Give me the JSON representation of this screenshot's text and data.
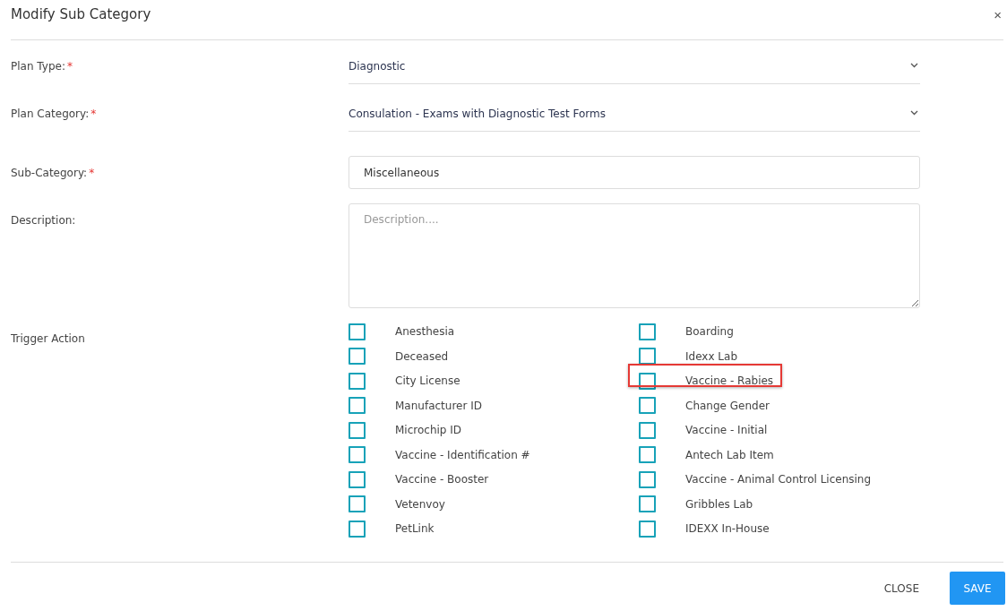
{
  "dialog": {
    "title": "Modify Sub Category",
    "close_icon": "×"
  },
  "fields": [
    {
      "kind": "select",
      "label": "Plan Type:",
      "required_mark": "*",
      "value": "Diagnostic"
    },
    {
      "kind": "select",
      "label": "Plan Category:",
      "required_mark": "*",
      "value": "Consulation - Exams with Diagnostic Test Forms"
    },
    {
      "kind": "input",
      "label": "Sub-Category:",
      "required_mark": "*",
      "value": "Miscellaneous"
    },
    {
      "kind": "textarea",
      "label": "Description:",
      "placeholder": "Description...."
    }
  ],
  "trigger_action": {
    "label": "Trigger Action",
    "options": [
      {
        "label": "Anesthesia",
        "checked": false,
        "highlighted": false
      },
      {
        "label": "Boarding",
        "checked": false,
        "highlighted": false
      },
      {
        "label": "Deceased",
        "checked": false,
        "highlighted": false
      },
      {
        "label": "Idexx Lab",
        "checked": false,
        "highlighted": false
      },
      {
        "label": "City License",
        "checked": false,
        "highlighted": false
      },
      {
        "label": "Vaccine - Rabies",
        "checked": false,
        "highlighted": true
      },
      {
        "label": "Manufacturer ID",
        "checked": false,
        "highlighted": false
      },
      {
        "label": "Change Gender",
        "checked": false,
        "highlighted": false
      },
      {
        "label": "Microchip ID",
        "checked": false,
        "highlighted": false
      },
      {
        "label": "Vaccine - Initial",
        "checked": false,
        "highlighted": false
      },
      {
        "label": "Vaccine - Identification #",
        "checked": false,
        "highlighted": false
      },
      {
        "label": "Antech Lab Item",
        "checked": false,
        "highlighted": false
      },
      {
        "label": "Vaccine - Booster",
        "checked": false,
        "highlighted": false
      },
      {
        "label": "Vaccine - Animal Control Licensing",
        "checked": false,
        "highlighted": false
      },
      {
        "label": "Vetenvoy",
        "checked": false,
        "highlighted": false
      },
      {
        "label": "Gribbles Lab",
        "checked": false,
        "highlighted": false
      },
      {
        "label": "PetLink",
        "checked": false,
        "highlighted": false
      },
      {
        "label": "IDEXX In-House",
        "checked": false,
        "highlighted": false
      }
    ]
  },
  "buttons": [
    {
      "kind": "text",
      "label": "CLOSE"
    },
    {
      "kind": "primary",
      "label": "SAVE"
    }
  ]
}
